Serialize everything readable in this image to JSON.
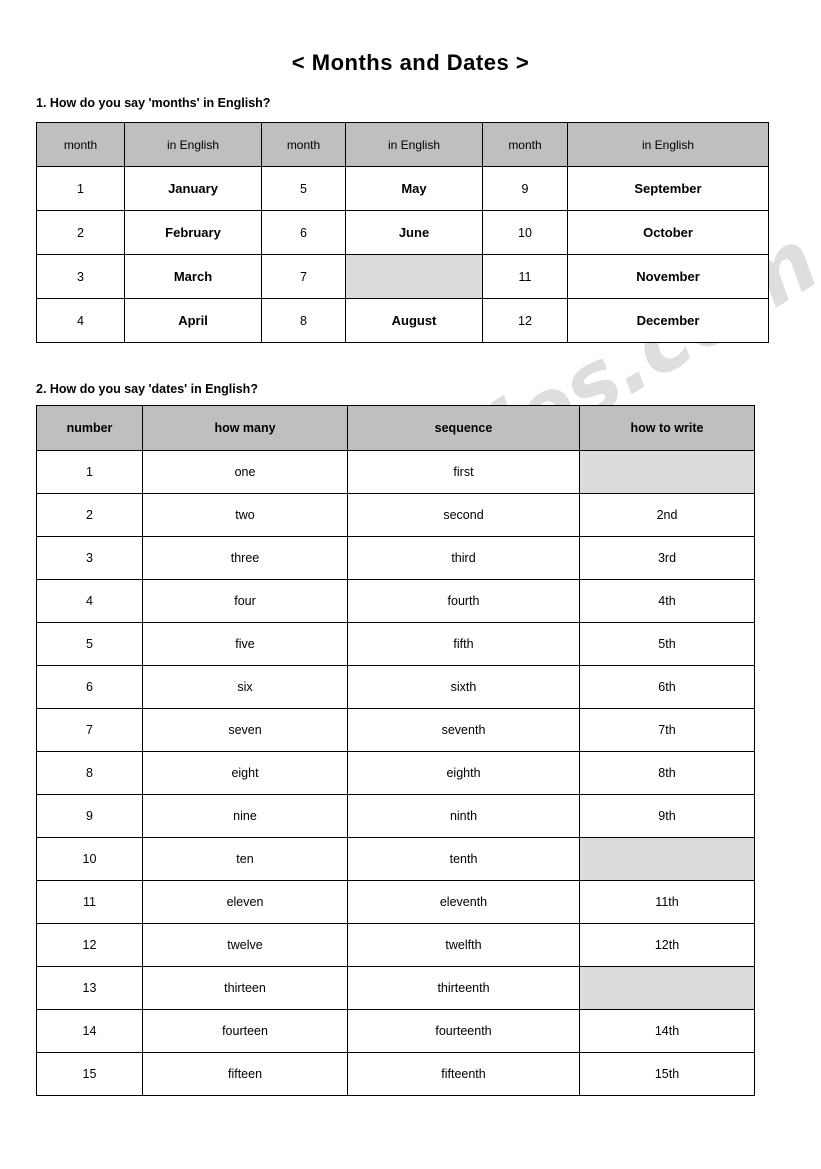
{
  "document": {
    "title": "< Months and Dates >"
  },
  "sections": [
    {
      "heading": "1. How do you say 'months' in English?"
    },
    {
      "heading": "2. How do you say 'dates' in English?"
    }
  ],
  "months_table": {
    "headers": [
      "month",
      "in English",
      "month",
      "in English",
      "month",
      "in English"
    ],
    "rows": [
      [
        "1",
        "January",
        "5",
        "May",
        "9",
        "September"
      ],
      [
        "2",
        "February",
        "6",
        "June",
        "10",
        "October"
      ],
      [
        "3",
        "March",
        "7",
        "",
        "11",
        "November"
      ],
      [
        "4",
        "April",
        "8",
        "August",
        "12",
        "December"
      ]
    ],
    "blank_cells": [
      [
        2,
        3
      ]
    ]
  },
  "dates_table": {
    "headers": [
      "number",
      "how many",
      "sequence",
      "how to write"
    ],
    "rows": [
      [
        "1",
        "one",
        "first",
        ""
      ],
      [
        "2",
        "two",
        "second",
        "2nd"
      ],
      [
        "3",
        "three",
        "third",
        "3rd"
      ],
      [
        "4",
        "four",
        "fourth",
        "4th"
      ],
      [
        "5",
        "five",
        "fifth",
        "5th"
      ],
      [
        "6",
        "six",
        "sixth",
        "6th"
      ],
      [
        "7",
        "seven",
        "seventh",
        "7th"
      ],
      [
        "8",
        "eight",
        "eighth",
        "8th"
      ],
      [
        "9",
        "nine",
        "ninth",
        "9th"
      ],
      [
        "10",
        "ten",
        "tenth",
        ""
      ],
      [
        "11",
        "eleven",
        "eleventh",
        "11th"
      ],
      [
        "12",
        "twelve",
        "twelfth",
        "12th"
      ],
      [
        "13",
        "thirteen",
        "thirteenth",
        ""
      ],
      [
        "14",
        "fourteen",
        "fourteenth",
        "14th"
      ],
      [
        "15",
        "fifteen",
        "fifteenth",
        "15th"
      ]
    ],
    "blank_cells": [
      [
        0,
        3
      ],
      [
        9,
        3
      ],
      [
        12,
        3
      ]
    ],
    "bold_cells": [
      [
        1,
        3
      ],
      [
        2,
        3
      ]
    ]
  },
  "watermark": {
    "text": "ESLprintables.com"
  },
  "colors": {
    "header_gray": "#bfbfbf",
    "blank_gray": "#dcdcdc",
    "border": "#000000",
    "text": "#000000",
    "page_background": "#ffffff"
  }
}
